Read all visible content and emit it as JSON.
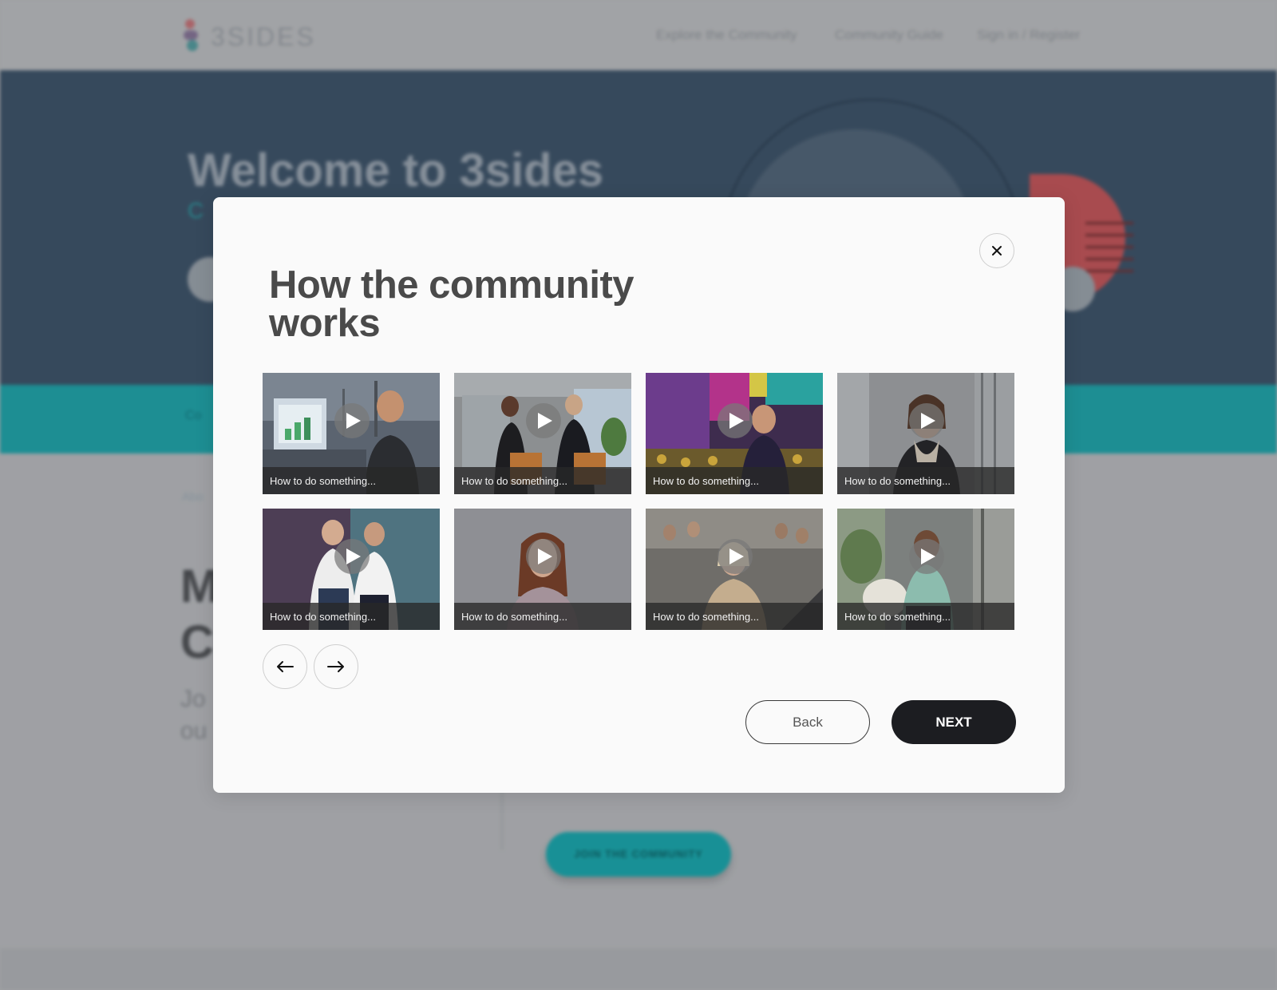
{
  "background": {
    "logo_text": "3SIDES",
    "nav": [
      "Explore the Community",
      "Community Guide",
      "Sign in / Register"
    ],
    "hero_title": "Welcome to 3sides",
    "hero_subtitle": "C",
    "band_text": "Co",
    "breadcrumb": "Abo",
    "big_heading": [
      "M",
      "C"
    ],
    "paragraph": [
      "Jo",
      "ou"
    ],
    "join_button": "JOIN THE COMMUNITY"
  },
  "modal": {
    "title": "How the community works",
    "close_icon": "close-icon",
    "videos": [
      {
        "caption": "How to do something..."
      },
      {
        "caption": "How to do something..."
      },
      {
        "caption": "How to do something..."
      },
      {
        "caption": "How to do something..."
      },
      {
        "caption": "How to do something..."
      },
      {
        "caption": "How to do something..."
      },
      {
        "caption": "How to do something..."
      },
      {
        "caption": "How to do something..."
      }
    ],
    "prev_icon": "arrow-left-icon",
    "next_icon": "arrow-right-icon",
    "back_label": "Back",
    "next_label": "NEXT"
  },
  "colors": {
    "modal_bg": "#fafafa",
    "next_button": "#1c1d21",
    "hero_bg": "#3a4e62",
    "teal_band": "#1f979d"
  }
}
